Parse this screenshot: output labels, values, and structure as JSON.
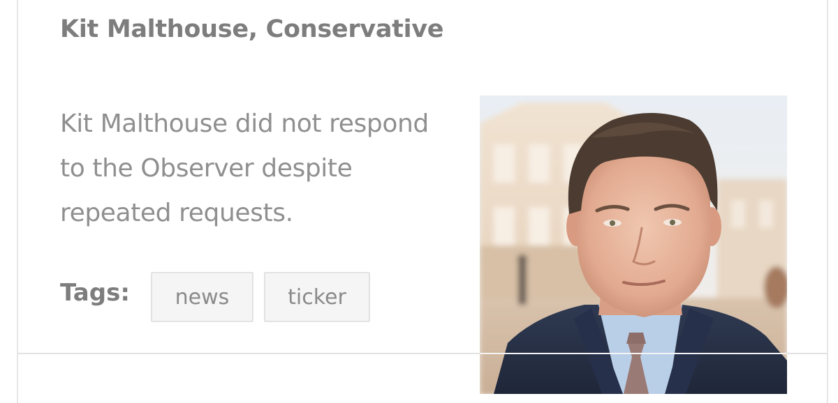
{
  "profile": {
    "name_heading": "Kit Malthouse, Conservative",
    "statement": "Kit Malthouse did not respond to the Observer despite repeated requests."
  },
  "tags": {
    "label": "Tags:",
    "items": [
      "news",
      "ticker"
    ]
  },
  "portrait": {
    "subject": "portrait-photo"
  },
  "colors": {
    "heading_text": "#7d7d7d",
    "body_text": "#8f8f8f",
    "tag_background": "#f5f5f5",
    "tag_border": "#e2e2e2",
    "divider": "#e2e2e2"
  }
}
